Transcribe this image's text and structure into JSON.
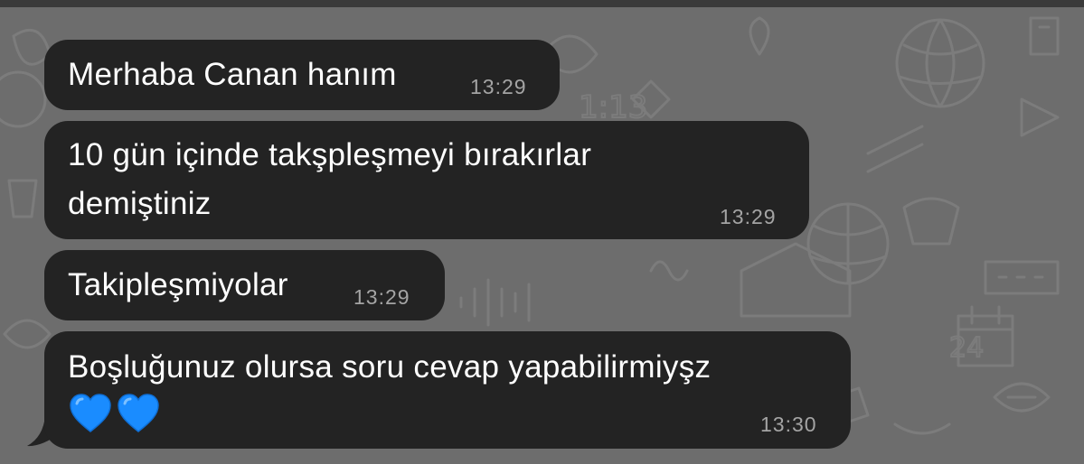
{
  "chat": {
    "wallpaper_color": "#6d6d6d",
    "bubble_color": "#232323",
    "time_color": "#a4a4a4",
    "messages": [
      {
        "lines": [
          "Merhaba Canan hanım"
        ],
        "time": "13:29"
      },
      {
        "lines": [
          "10 gün içinde takşpleşmeyi bırakırlar",
          "demiştiniz"
        ],
        "time": "13:29"
      },
      {
        "lines": [
          "Takipleşmiyolar"
        ],
        "time": "13:29"
      },
      {
        "lines": [
          "Boşluğunuz olursa soru cevap yapabilirmiyşz"
        ],
        "emojis": [
          "blue-heart-icon",
          "blue-heart-icon"
        ],
        "time": "13:30"
      }
    ]
  }
}
